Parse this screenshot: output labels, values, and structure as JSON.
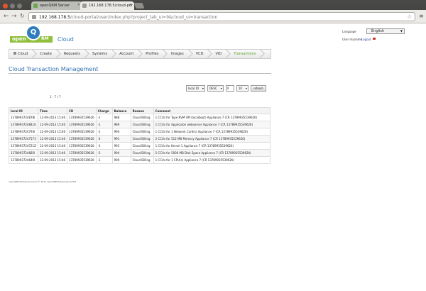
{
  "browser": {
    "tabs": [
      {
        "label": "openQRM Server"
      },
      {
        "label": "192.168.178.5/cloud-por"
      }
    ],
    "url_host": "192.168.178.5",
    "url_path": "/cloud-portal/user/index.php?project_tab_ui=9&cloud_ui=transaction"
  },
  "header": {
    "logo_open": "open",
    "logo_q": "Q",
    "logo_rm": "RM",
    "brand": "Cloud",
    "language_label": "Language",
    "language_value": "English",
    "user_label": "User myname",
    "logout": "Logout"
  },
  "nav": {
    "items": [
      {
        "label": "Cloud"
      },
      {
        "label": "Create"
      },
      {
        "label": "Requests"
      },
      {
        "label": "Systems"
      },
      {
        "label": "Account"
      },
      {
        "label": "Profiles"
      },
      {
        "label": "Images"
      },
      {
        "label": "VCD"
      },
      {
        "label": "VID"
      },
      {
        "label": "Transactions"
      }
    ]
  },
  "main": {
    "title": "Cloud Transaction Management",
    "sort_by": "local ID",
    "order": "DESC",
    "offset": "0",
    "limit": "10",
    "refresh": "refresh",
    "pager": "1 - 7 / 7",
    "table": {
      "headers": [
        "local ID",
        "Time",
        "CR",
        "Charge",
        "Balance",
        "Reason",
        "Comment"
      ],
      "rows": [
        [
          "1378993724878I",
          "12-09-2013 15:46",
          "1378993553962б",
          "-1",
          "988",
          "Cloud Billing",
          "1 CCUs for Type KVM VM (localboot) Appliance 7 (CR 1378993553962б)"
        ],
        [
          "1378993724841б",
          "12-09-2013 15:46",
          "1378993553962б",
          "-1",
          "989",
          "Cloud Billing",
          "1 CCUs for Applicaton webserver Appliance 7 (CR 1378993553962б)"
        ],
        [
          "1378993724793I",
          "12-09-2013 15:46",
          "1378993553962б",
          "-1",
          "990",
          "Cloud Billing",
          "1 CCUs for 1 Network Card(s) Appliance 7 (CR 1378993553962б)"
        ],
        [
          "1378993724757З",
          "12-09-2013 15:46",
          "1378993553962б",
          "-2",
          "991",
          "Cloud Billing",
          "2 CCUs for 512 MB Memory Appliance 7 (CR 1378993553962б)"
        ],
        [
          "1378993724721Z",
          "12-09-2013 15:46",
          "1378993553962б",
          "-1",
          "993",
          "Cloud Billing",
          "1 CCUs for Kernel 1 Appliance 7 (CR 1378993553962б)"
        ],
        [
          "1378993724685I",
          "12-09-2013 15:46",
          "1378993553962б",
          "-5",
          "994",
          "Cloud Billing",
          "5 CCUs for 5000 MB Disk Space Appliance 7 (CR 1378993553962б)"
        ],
        [
          "1378993724649I",
          "12-09-2013 15:46",
          "1378993553962б",
          "-1",
          "999",
          "Cloud Billing",
          "1 CCUs for 1 CPU(s) Appliance 7 (CR 1378993553962б)"
        ]
      ]
    }
  },
  "footer": "openQRM Enterprise Cloud   © 2013 openQRM Enterprise GmbH"
}
